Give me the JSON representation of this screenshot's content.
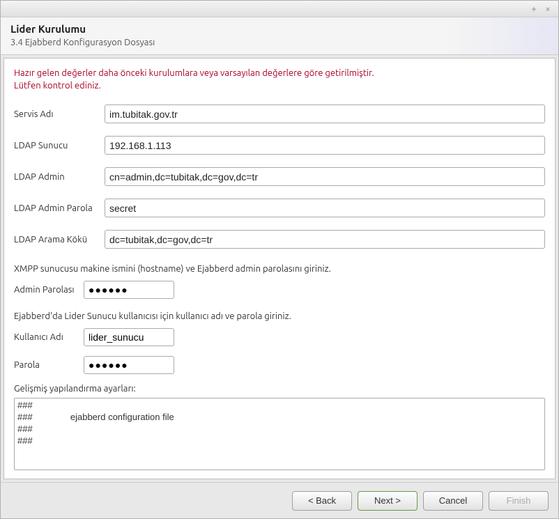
{
  "window": {
    "title": "Lider Kurulumu",
    "subtitle": "3.4 Ejabberd Konfigurasyon Dosyası"
  },
  "warning": {
    "line1": "Hazır gelen değerler daha önceki kurulumlara veya varsayılan değerlere göre getirilmiştir.",
    "line2": "Lütfen kontrol ediniz."
  },
  "labels": {
    "service_name": "Servis Adı",
    "ldap_server": "LDAP Sunucu",
    "ldap_admin": "LDAP Admin",
    "ldap_admin_password": "LDAP Admin Parola",
    "ldap_search_root": "LDAP Arama Kökü",
    "xmpp_hint": "XMPP sunucusu makine ismini (hostname) ve Ejabberd admin parolasını giriniz.",
    "admin_password": "Admin Parolası",
    "ejabberd_hint": "Ejabberd'da Lider Sunucu kullanıcısı için kullanıcı adı ve parola giriniz.",
    "username": "Kullanıcı Adı",
    "password": "Parola",
    "advanced_section": "Gelişmiş yapılandırma ayarları:"
  },
  "values": {
    "service_name": "im.tubitak.gov.tr",
    "ldap_server": "192.168.1.113",
    "ldap_admin": "cn=admin,dc=tubitak,dc=gov,dc=tr",
    "ldap_admin_password": "secret",
    "ldap_search_root": "dc=tubitak,dc=gov,dc=tr",
    "admin_password": "●●●●●●",
    "username": "lider_sunucu",
    "password": "●●●●●●",
    "config_text": "###\n###               ejabberd configuration file\n###\n###"
  },
  "buttons": {
    "back": "< Back",
    "next": "Next >",
    "cancel": "Cancel",
    "finish": "Finish"
  }
}
